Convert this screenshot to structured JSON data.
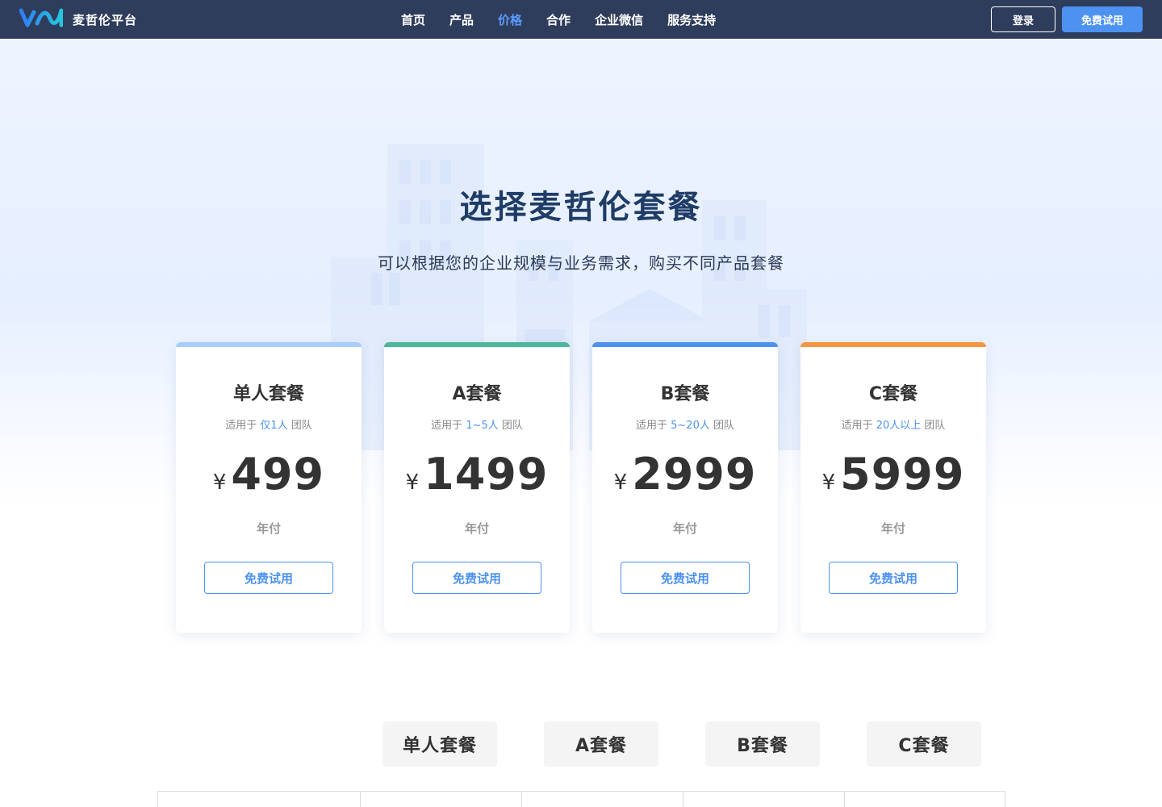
{
  "brand": {
    "name": "麦哲伦平台"
  },
  "nav": {
    "items": [
      {
        "label": "首页",
        "active": false
      },
      {
        "label": "产品",
        "active": false
      },
      {
        "label": "价格",
        "active": true
      },
      {
        "label": "合作",
        "active": false
      },
      {
        "label": "企业微信",
        "active": false
      },
      {
        "label": "服务支持",
        "active": false
      }
    ],
    "login_label": "登录",
    "trial_label": "免费试用"
  },
  "hero": {
    "title": "选择麦哲伦套餐",
    "subtitle": "可以根据您的企业规模与业务需求，购买不同产品套餐"
  },
  "plans": [
    {
      "name": "单人套餐",
      "fit_prefix": "适用于",
      "fit_value": "仅1人",
      "fit_suffix": "团队",
      "currency": "¥",
      "price": "499",
      "period": "年付",
      "button": "免费试用",
      "accent": "#a9cdfa"
    },
    {
      "name": "A套餐",
      "fit_prefix": "适用于",
      "fit_value": "1~5人",
      "fit_suffix": "团队",
      "currency": "¥",
      "price": "1499",
      "period": "年付",
      "button": "免费试用",
      "accent": "#4bb89a"
    },
    {
      "name": "B套餐",
      "fit_prefix": "适用于",
      "fit_value": "5~20人",
      "fit_suffix": "团队",
      "currency": "¥",
      "price": "2999",
      "period": "年付",
      "button": "免费试用",
      "accent": "#4d92f0"
    },
    {
      "name": "C套餐",
      "fit_prefix": "适用于",
      "fit_value": "20人以上",
      "fit_suffix": "团队",
      "currency": "¥",
      "price": "5999",
      "period": "年付",
      "button": "免费试用",
      "accent": "#f5963f"
    }
  ],
  "comparison": {
    "columns": [
      "单人套餐",
      "A套餐",
      "B套餐",
      "C套餐"
    ]
  },
  "colors": {
    "header_bg": "#2f3d5c",
    "primary": "#4d92f0",
    "title": "#1f3c66"
  }
}
